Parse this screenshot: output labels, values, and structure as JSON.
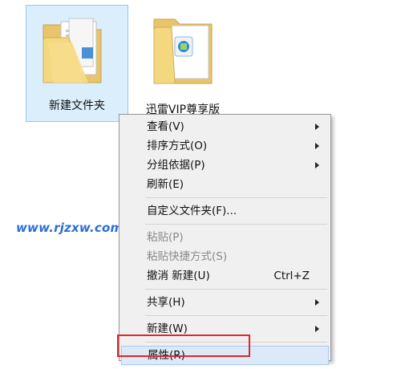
{
  "desktop": {
    "folders": [
      {
        "label": "新建文件夹",
        "icon": "folder-with-documents-icon"
      },
      {
        "label": "迅雷VIP尊享版",
        "icon": "folder-with-app-icon"
      }
    ]
  },
  "watermark": "www.rjzxw.com",
  "context_menu": {
    "items": [
      {
        "label": "查看(V)",
        "submenu": true
      },
      {
        "label": "排序方式(O)",
        "submenu": true
      },
      {
        "label": "分组依据(P)",
        "submenu": true
      },
      {
        "label": "刷新(E)"
      },
      {
        "separator": true
      },
      {
        "label": "自定义文件夹(F)..."
      },
      {
        "separator": true
      },
      {
        "label": "粘贴(P)",
        "disabled": true
      },
      {
        "label": "粘贴快捷方式(S)",
        "disabled": true
      },
      {
        "label": "撤消 新建(U)",
        "shortcut": "Ctrl+Z"
      },
      {
        "separator": true
      },
      {
        "label": "共享(H)",
        "submenu": true
      },
      {
        "separator": true
      },
      {
        "label": "新建(W)",
        "submenu": true
      },
      {
        "separator": true
      },
      {
        "label": "属性(R)",
        "highlighted": true
      }
    ]
  },
  "colors": {
    "selection": "#dbeefc",
    "menu_bg": "#f0f0f0",
    "menu_highlight": "#dbe9f8",
    "annotation": "#e0262c",
    "watermark": "#2a6fd6"
  }
}
